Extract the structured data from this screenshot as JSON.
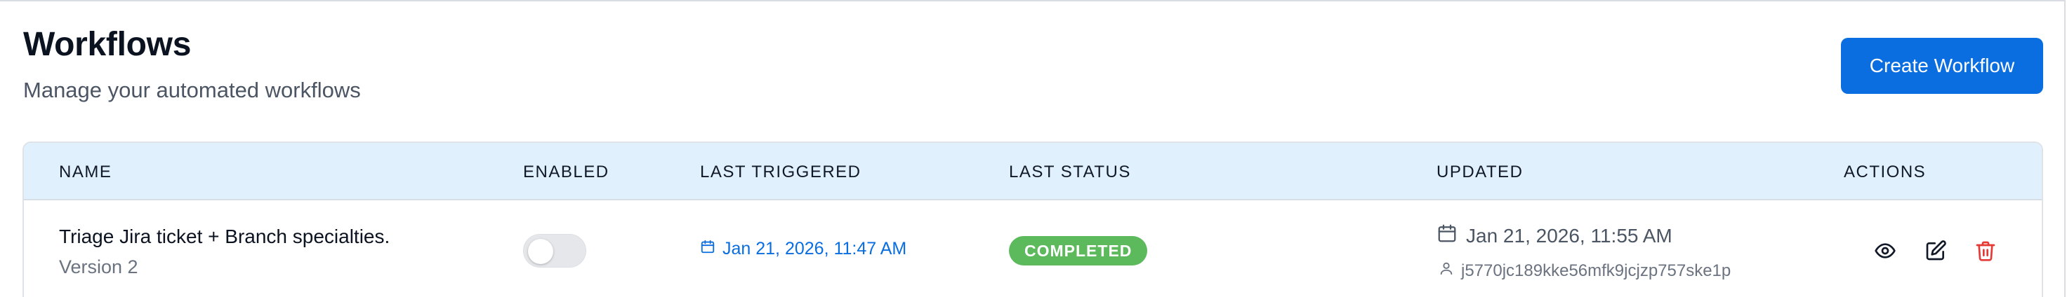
{
  "header": {
    "title": "Workflows",
    "subtitle": "Manage your automated workflows",
    "create_label": "Create Workflow"
  },
  "table": {
    "columns": [
      "NAME",
      "ENABLED",
      "LAST TRIGGERED",
      "LAST STATUS",
      "UPDATED",
      "ACTIONS"
    ],
    "rows": [
      {
        "name": "Triage Jira ticket + Branch specialties.",
        "version": "Version 2",
        "enabled": false,
        "last_triggered": "Jan 21, 2026, 11:47 AM",
        "last_status": "COMPLETED",
        "updated": "Jan 21, 2026, 11:55 AM",
        "updated_by": "j5770jc189kke56mfk9jcjzp757ske1p"
      }
    ]
  },
  "icons": {
    "triggered": "calendar-icon",
    "updated": "calendar-icon",
    "updated_by": "user-icon",
    "view": "eye-icon",
    "edit": "edit-icon",
    "delete": "trash-icon"
  },
  "colors": {
    "primary": "#0a6ee0",
    "header_bg": "#e0f0fd",
    "status_completed": "#5cb95c",
    "delete": "#e53935"
  }
}
